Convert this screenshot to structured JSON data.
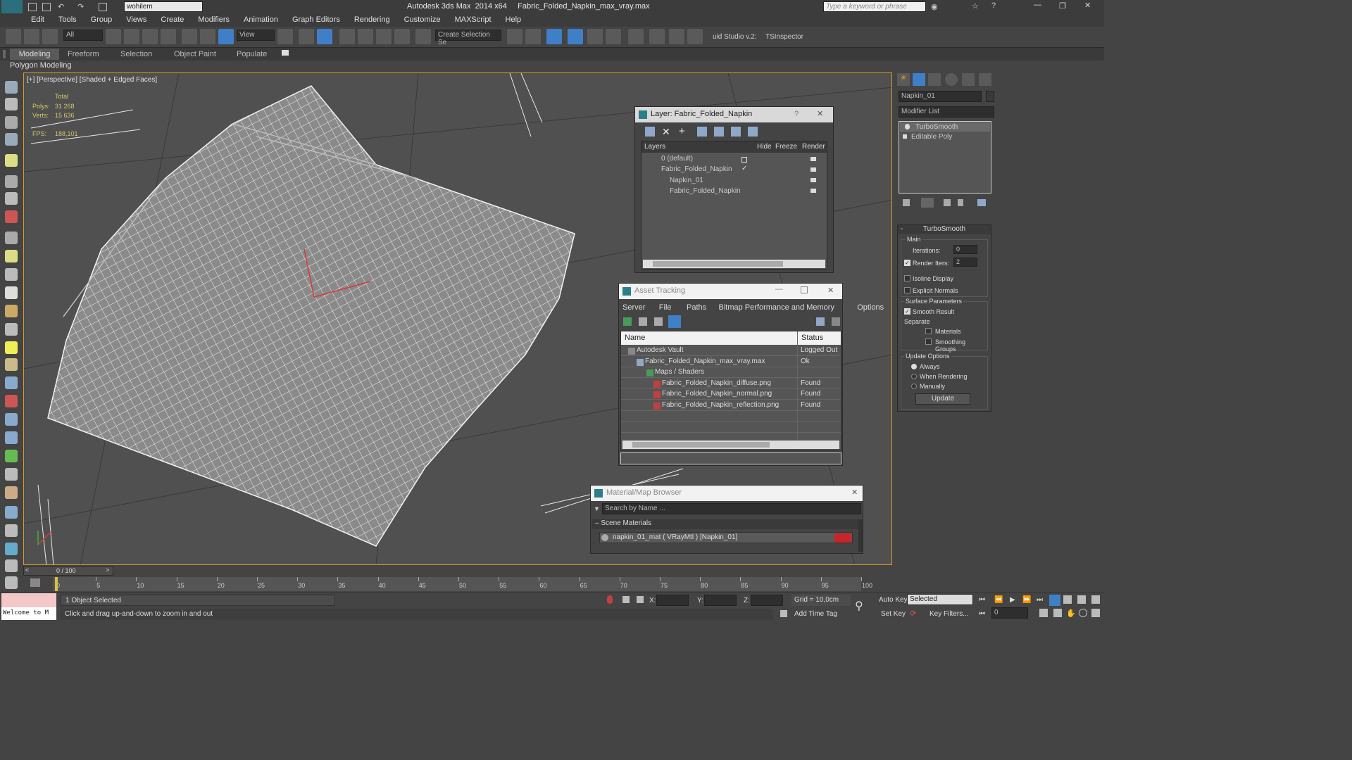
{
  "window": {
    "title": "Autodesk 3ds Max  2014 x64     Fabric_Folded_Napkin_max_vray.max",
    "workspace": "wohilem",
    "search_placeholder": "Type a keyword or phrase"
  },
  "menu": [
    "Edit",
    "Tools",
    "Group",
    "Views",
    "Create",
    "Modifiers",
    "Animation",
    "Graph Editors",
    "Rendering",
    "Customize",
    "MAXScript",
    "Help"
  ],
  "toolbar": {
    "selection_filter": "All",
    "ref_coord": "View",
    "named_selection": "Create Selection Se",
    "plugin1": "uid Studio v.2:",
    "plugin2": "TSInspector"
  },
  "ribbon": {
    "tabs": [
      "Modeling",
      "Freeform",
      "Selection",
      "Object Paint",
      "Populate"
    ],
    "panel": "Polygon Modeling"
  },
  "viewport": {
    "label": "[+] [Perspective] [Shaded + Edged Faces]",
    "stats_title": "Total",
    "polys_label": "Polys:",
    "polys": "31 268",
    "verts_label": "Verts:",
    "verts": "15 636",
    "fps_label": "FPS:",
    "fps": "188,101"
  },
  "layer_dialog": {
    "title": "Layer: Fabric_Folded_Napkin",
    "cols": {
      "layers": "Layers",
      "hide": "Hide",
      "freeze": "Freeze",
      "render": "Render"
    },
    "rows": [
      "0 (default)",
      "Fabric_Folded_Napkin",
      "Napkin_01",
      "Fabric_Folded_Napkin"
    ]
  },
  "asset_tracking": {
    "title": "Asset Tracking",
    "menu": [
      "Server",
      "File",
      "Paths",
      "Bitmap Performance and Memory",
      "Options"
    ],
    "col_name": "Name",
    "col_status": "Status",
    "rows": [
      {
        "name": "Autodesk Vault",
        "status": "Logged Out ."
      },
      {
        "name": "Fabric_Folded_Napkin_max_vray.max",
        "status": "Ok"
      },
      {
        "name": "Maps / Shaders",
        "status": ""
      },
      {
        "name": "Fabric_Folded_Napkin_diffuse.png",
        "status": "Found"
      },
      {
        "name": "Fabric_Folded_Napkin_normal.png",
        "status": "Found"
      },
      {
        "name": "Fabric_Folded_Napkin_reflection.png",
        "status": "Found"
      }
    ]
  },
  "material_browser": {
    "title": "Material/Map Browser",
    "search": "Search by Name ...",
    "section": "Scene Materials",
    "item": "napkin_01_mat  ( VRayMtl ) [Napkin_01]"
  },
  "command_panel": {
    "object_name": "Napkin_01",
    "modifier_list": "Modifier List",
    "stack": [
      "TurboSmooth",
      "Editable Poly"
    ],
    "rollout": "TurboSmooth",
    "main": "Main",
    "iterations_label": "Iterations:",
    "iterations": "0",
    "render_iters_label": "Render Iters:",
    "render_iters": "2",
    "isoline": "Isoline Display",
    "explicit": "Explicit Normals",
    "surface": "Surface Parameters",
    "smooth_result": "Smooth Result",
    "separate": "Separate",
    "materials": "Materials",
    "smoothing_groups": "Smoothing Groups",
    "update_options": "Update Options",
    "always": "Always",
    "when_rendering": "When Rendering",
    "manually": "Manually",
    "update": "Update"
  },
  "timeline": {
    "frame": "0 / 100",
    "ticks": [
      "0",
      "5",
      "10",
      "15",
      "20",
      "25",
      "30",
      "35",
      "40",
      "45",
      "50",
      "55",
      "60",
      "65",
      "70",
      "75",
      "80",
      "85",
      "90",
      "95",
      "100"
    ]
  },
  "status": {
    "welcome": "Welcome to M",
    "selected": "1 Object Selected",
    "prompt": "Click and drag up-and-down to zoom in and out",
    "x": "X:",
    "y": "Y:",
    "z": "Z:",
    "grid": "Grid = 10,0cm",
    "add_time_tag": "Add Time Tag",
    "auto_key": "Auto Key",
    "set_key": "Set Key",
    "key_mode": "Selected",
    "key_filters": "Key Filters...",
    "frame": "0"
  }
}
